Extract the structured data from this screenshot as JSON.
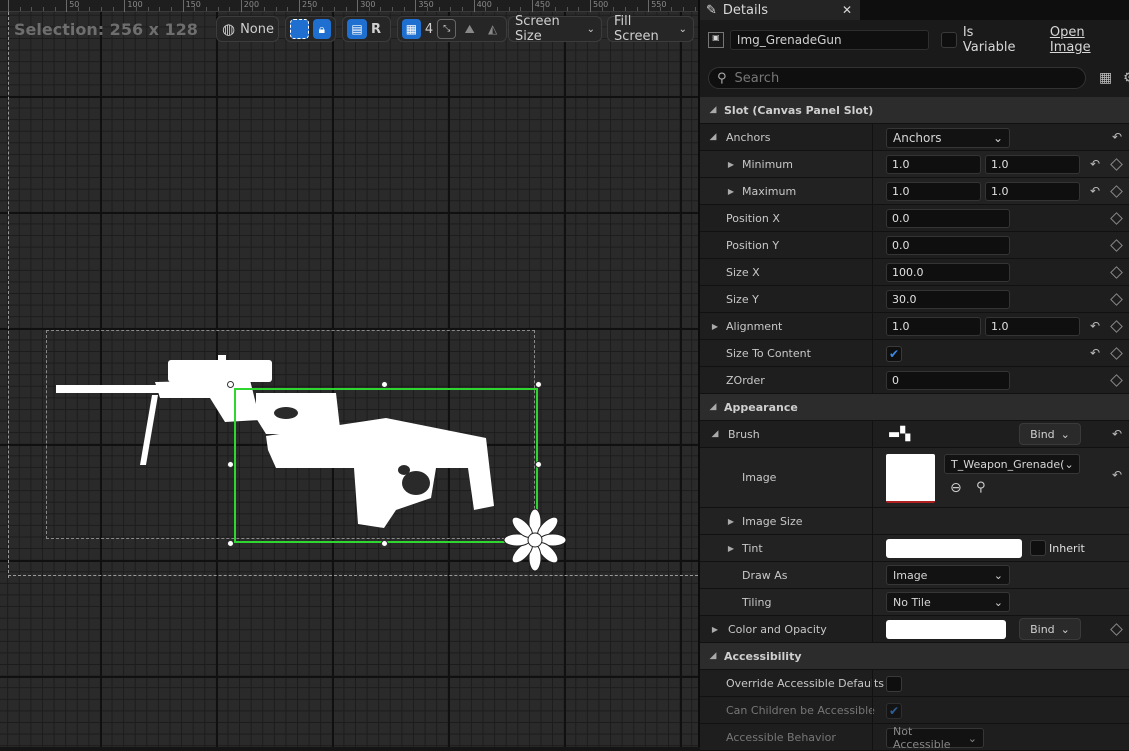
{
  "viewport": {
    "selection_label": "Selection: 256 x 128",
    "ruler_ticks": [
      "50",
      "100",
      "150",
      "200",
      "250",
      "300",
      "350",
      "400",
      "450",
      "500",
      "550"
    ],
    "toolbar": {
      "none_label": "None",
      "r_label": "R",
      "grid_value": "4",
      "screen_size_label": "Screen Size",
      "fill_screen_label": "Fill Screen"
    }
  },
  "details": {
    "tab_title": "Details",
    "widget_name": "Img_GrenadeGun",
    "is_variable_label": "Is Variable",
    "open_image_label": "Open Image",
    "search_placeholder": "Search",
    "slot_category": "Slot (Canvas Panel Slot)",
    "anchors": {
      "label": "Anchors",
      "dropdown": "Anchors"
    },
    "minimum": {
      "label": "Minimum",
      "x": "1.0",
      "y": "1.0"
    },
    "maximum": {
      "label": "Maximum",
      "x": "1.0",
      "y": "1.0"
    },
    "position_x": {
      "label": "Position X",
      "value": "0.0"
    },
    "position_y": {
      "label": "Position Y",
      "value": "0.0"
    },
    "size_x": {
      "label": "Size X",
      "value": "100.0"
    },
    "size_y": {
      "label": "Size Y",
      "value": "30.0"
    },
    "alignment": {
      "label": "Alignment",
      "x": "1.0",
      "y": "1.0"
    },
    "size_to_content": {
      "label": "Size To Content",
      "checked": true
    },
    "zorder": {
      "label": "ZOrder",
      "value": "0"
    },
    "appearance_category": "Appearance",
    "brush": {
      "label": "Brush",
      "bind_label": "Bind"
    },
    "image": {
      "label": "Image",
      "asset": "T_Weapon_Grenade("
    },
    "image_size": {
      "label": "Image Size"
    },
    "tint": {
      "label": "Tint",
      "inherit_label": "Inherit"
    },
    "draw_as": {
      "label": "Draw As",
      "value": "Image"
    },
    "tiling": {
      "label": "Tiling",
      "value": "No Tile"
    },
    "color_opacity": {
      "label": "Color and Opacity",
      "bind_label": "Bind"
    },
    "accessibility_category": "Accessibility",
    "override_accessible": {
      "label": "Override Accessible Defaults"
    },
    "can_children": {
      "label": "Can Children be Accessible"
    },
    "accessible_behavior": {
      "label": "Accessible Behavior",
      "value": "Not Accessible"
    }
  }
}
